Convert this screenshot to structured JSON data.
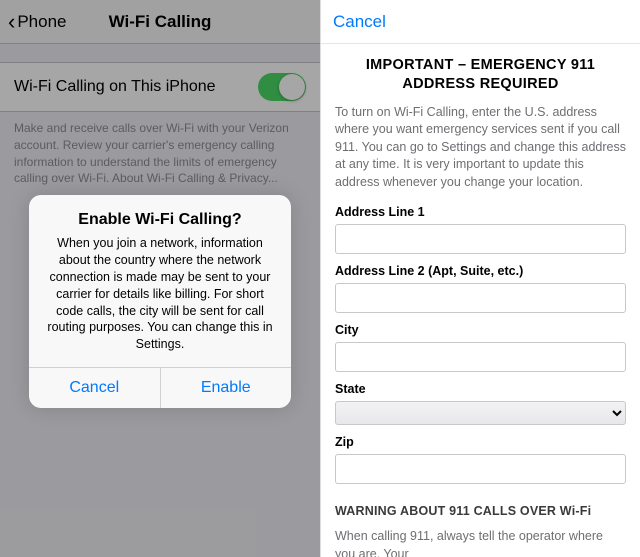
{
  "left": {
    "back_label": "Phone",
    "title": "Wi-Fi Calling",
    "toggle_label": "Wi-Fi Calling on This iPhone",
    "description": "Make and receive calls over Wi-Fi with your Verizon account. Review your carrier's emergency calling information to understand the limits of emergency calling over Wi-Fi. About Wi-Fi Calling & Privacy..."
  },
  "alert": {
    "title": "Enable Wi-Fi Calling?",
    "body": "When you join a network, information about the country where the network connection is made may be sent to your carrier for details like billing. For short code calls, the city will be sent for call routing purposes. You can change this in Settings.",
    "cancel": "Cancel",
    "enable": "Enable"
  },
  "right": {
    "cancel": "Cancel",
    "important_title": "IMPORTANT – EMERGENCY 911 ADDRESS REQUIRED",
    "info": "To turn on Wi-Fi Calling, enter the U.S. address where you want emergency services sent if you call 911. You can go to Settings and change this address at any time. It is very important to update this address whenever you change your location.",
    "labels": {
      "addr1": "Address Line 1",
      "addr2": "Address Line 2 (Apt, Suite, etc.)",
      "city": "City",
      "state": "State",
      "zip": "Zip"
    },
    "warning_title": "WARNING ABOUT 911 CALLS OVER Wi-Fi",
    "warning_text": "When calling 911, always tell the operator where you are. Your"
  }
}
